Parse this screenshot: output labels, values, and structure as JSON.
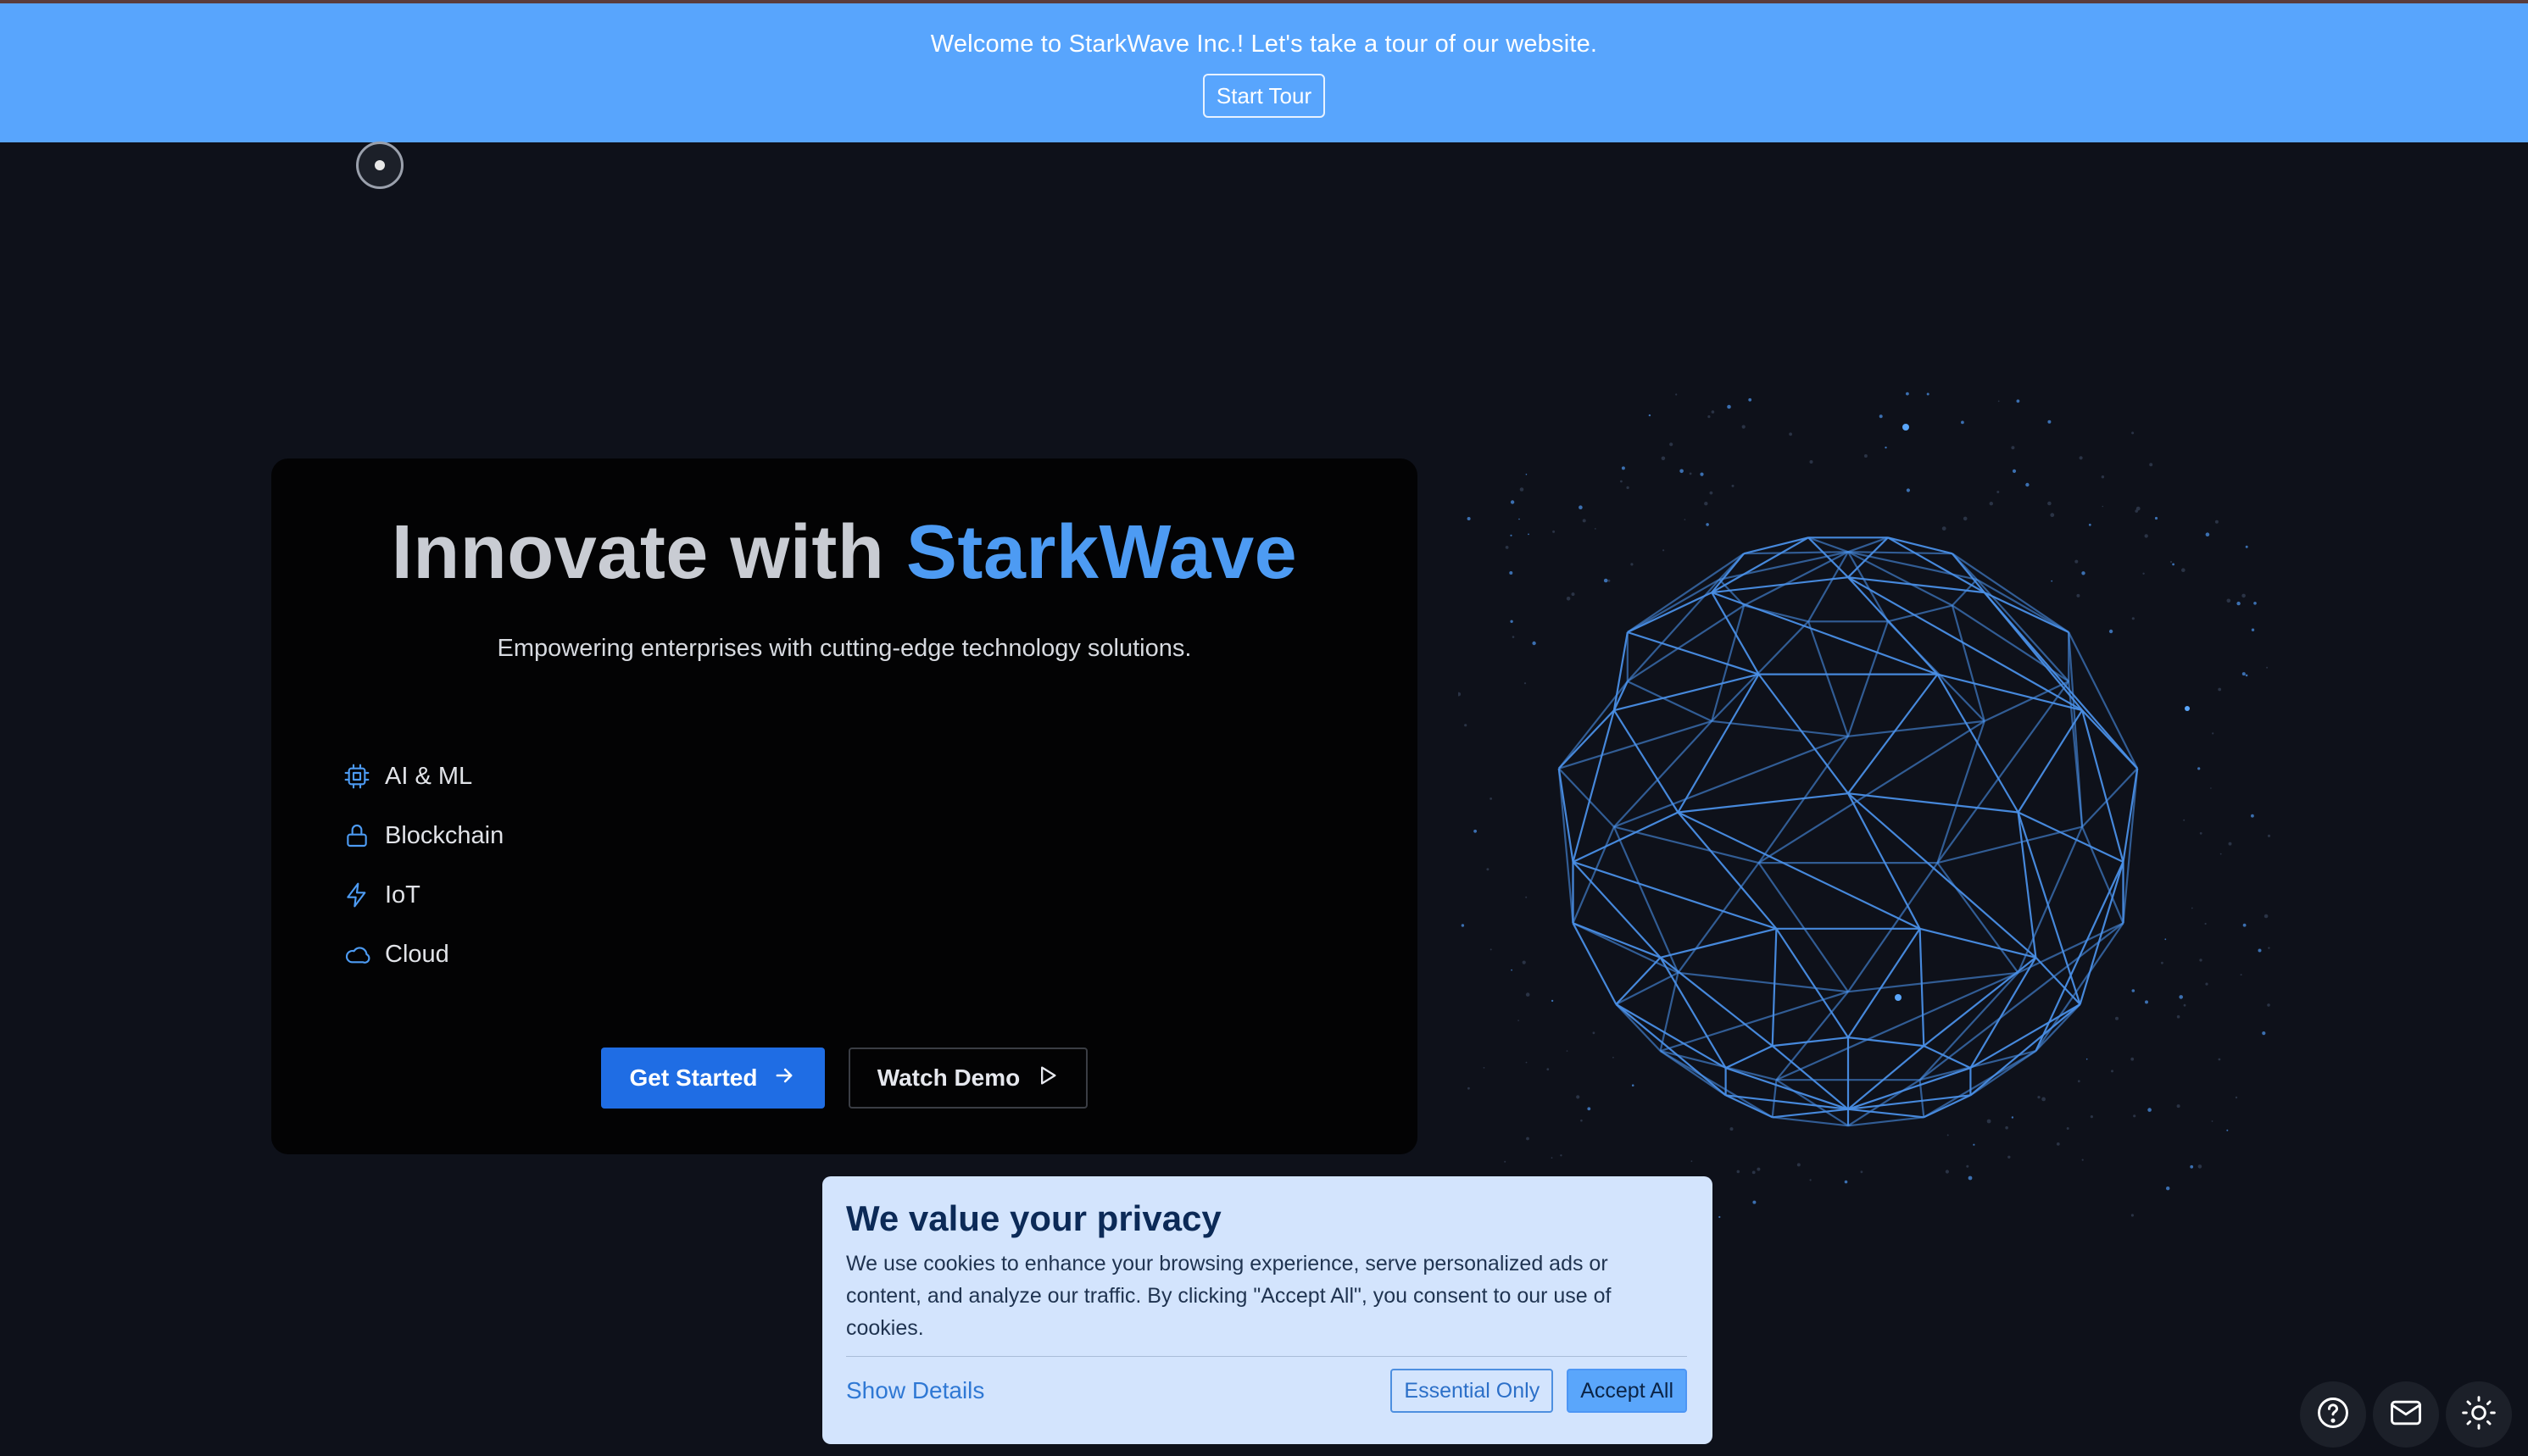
{
  "tour": {
    "message": "Welcome to StarkWave Inc.! Let's take a tour of our website.",
    "button_label": "Start Tour"
  },
  "hero": {
    "title_prefix": "Innovate with ",
    "title_accent": "StarkWave",
    "subtitle": "Empowering enterprises with cutting-edge technology solutions.",
    "technologies": [
      {
        "label": "AI & ML",
        "icon": "cpu-icon"
      },
      {
        "label": "Blockchain",
        "icon": "lock-icon"
      },
      {
        "label": "IoT",
        "icon": "lightning-icon"
      },
      {
        "label": "Cloud",
        "icon": "cloud-icon"
      }
    ],
    "primary_button": "Get Started",
    "secondary_button": "Watch Demo"
  },
  "cookie": {
    "title": "We value your privacy",
    "text": "We use cookies to enhance your browsing experience, serve personalized ads or content, and analyze our traffic. By clicking \"Accept All\", you consent to our use of cookies.",
    "show_details": "Show Details",
    "essential_label": "Essential Only",
    "accept_label": "Accept All"
  },
  "floating_actions": [
    "help-icon",
    "mail-icon",
    "sun-icon"
  ],
  "colors": {
    "background": "#0e111a",
    "banner": "#58a5fd",
    "accent": "#4d9bf3",
    "primary_button": "#1f6de4",
    "cookie_bg": "#d3e4fd"
  }
}
